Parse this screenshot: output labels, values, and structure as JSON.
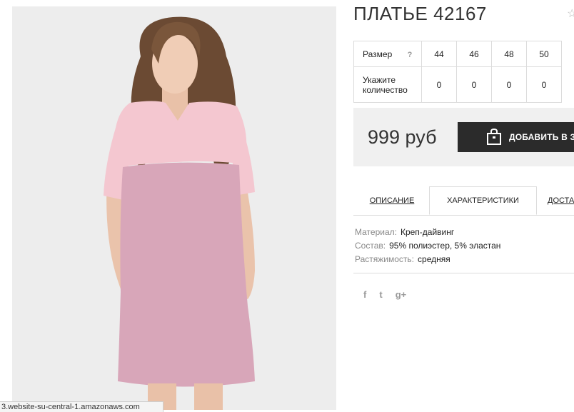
{
  "product": {
    "title": "ПЛАТЬЕ 42167",
    "favorite_icon": "star-outline-icon"
  },
  "sizes": {
    "header_label": "Размер",
    "help_glyph": "?",
    "values": [
      "44",
      "46",
      "48",
      "50"
    ],
    "qty_label": "Укажите количество",
    "quantities": [
      "0",
      "0",
      "0",
      "0"
    ]
  },
  "purchase": {
    "price": "999 руб",
    "add_button_label": "ДОБАВИТЬ В ЗАКАЗ",
    "button_icon": "shopping-bag-icon"
  },
  "tabs": [
    "ОПИСАНИЕ",
    "ХАРАКТЕРИСТИКИ",
    "ДОСТАВКА"
  ],
  "specs": [
    {
      "label": "Материал:",
      "value": "Креп-дайвинг"
    },
    {
      "label": "Состав:",
      "value": "95% полиэстер, 5% эластан"
    },
    {
      "label": "Растяжимость:",
      "value": "средняя"
    }
  ],
  "social": [
    "f",
    "t",
    "g+"
  ],
  "status_bar": {
    "url": "3.website-su-central-1.amazonaws.com"
  },
  "colors": {
    "button_bg": "#2b2b2b",
    "buybox_bg": "#f0f0f0",
    "dress_top": "#f4c7d0",
    "dress_bottom": "#d8a6b9"
  }
}
